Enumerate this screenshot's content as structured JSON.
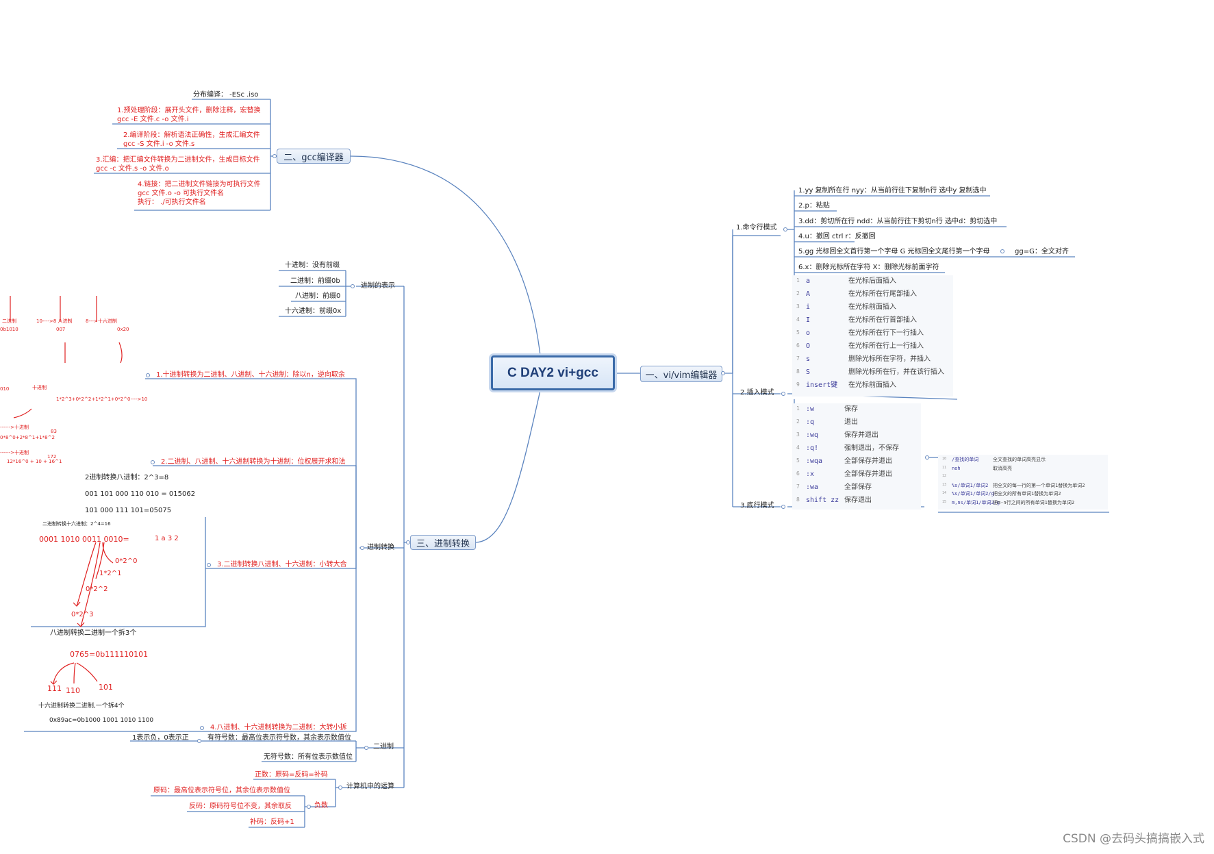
{
  "root": {
    "label": "C DAY2 vi+gcc"
  },
  "branches": {
    "gcc": "二、gcc编译器",
    "vim": "一、vi/vim编辑器",
    "radix": "三、进制转换"
  },
  "gcc_items": {
    "separate": "分布编译：  -ESc  .iso",
    "preprocess": [
      "1.预处理阶段：展开头文件，删除注释，宏替换",
      "gcc -E 文件.c -o 文件.i"
    ],
    "compile": [
      "2.编译阶段：解析语法正确性，生成汇编文件",
      "gcc -S 文件.i -o 文件.s"
    ],
    "assemble": [
      "3.汇编：把汇编文件转换为二进制文件，生成目标文件",
      "gcc -c 文件.s -o 文件.o"
    ],
    "link": [
      "4.链接：把二进制文件链接为可执行文件",
      "gcc 文件.o -o 可执行文件名",
      "执行：  ./可执行文件名"
    ]
  },
  "vim": {
    "command_mode": {
      "label": "1.命令行模式",
      "items": [
        "1.yy 复制所在行 nyy：从当前行往下复制n行 选中y 复制选中",
        "2.p：粘贴",
        "3.dd：剪切所在行 ndd：从当前行往下剪切n行  选中d：剪切选中",
        "4.u：撤回          ctrl r：反撤回",
        "5.gg 光标回全文首行第一个字母 G 光标回全文尾行第一个字母",
        "6.x：删除光标所在字符 X：删除光标前面字符"
      ],
      "extra": "gg=G：全文对齐"
    },
    "insert_mode": {
      "label": "2.插入模式",
      "rows": [
        {
          "n": "1",
          "k": "a",
          "d": "在光标后面插入"
        },
        {
          "n": "2",
          "k": "A",
          "d": "在光标所在行尾部插入"
        },
        {
          "n": "3",
          "k": "i",
          "d": "在光标前面插入"
        },
        {
          "n": "4",
          "k": "I",
          "d": "在光标所在行首部插入"
        },
        {
          "n": "5",
          "k": "o",
          "d": "在光标所在行下一行插入"
        },
        {
          "n": "6",
          "k": "O",
          "d": "在光标所在行上一行插入"
        },
        {
          "n": "7",
          "k": "s",
          "d": "删除光标所在字符，并插入"
        },
        {
          "n": "8",
          "k": "S",
          "d": "删除光标所在行，并在该行插入"
        },
        {
          "n": "9",
          "k": "insert键",
          "d": "在光标前面插入"
        }
      ]
    },
    "lastline_mode": {
      "label": "3.底行模式",
      "rows": [
        {
          "n": "1",
          "k": ":w",
          "d": "保存"
        },
        {
          "n": "2",
          "k": ":q",
          "d": "退出"
        },
        {
          "n": "3",
          "k": ":wq",
          "d": "保存并退出"
        },
        {
          "n": "4",
          "k": ":q!",
          "d": "强制退出，不保存"
        },
        {
          "n": "5",
          "k": ":wqa",
          "d": "全部保存并退出"
        },
        {
          "n": "6",
          "k": ":x",
          "d": "全部保存并退出"
        },
        {
          "n": "7",
          "k": ":wa",
          "d": "全部保存"
        },
        {
          "n": "8",
          "k": "shift zz",
          "d": "保存退出"
        }
      ],
      "search_rows": [
        {
          "n": "10",
          "k": "/查找的单词",
          "d": "全文查找的单词高亮显示"
        },
        {
          "n": "11",
          "k": "noh",
          "d": "取消高亮"
        },
        {
          "n": "12",
          "k": "",
          "d": ""
        },
        {
          "n": "13",
          "k": "%s/单词1/单词2",
          "d": "把全文的每一行的第一个单词1替换为单词2"
        },
        {
          "n": "14",
          "k": "%s/单词1/单词2/g",
          "d": "把全文的所有单词1替换为单词2"
        },
        {
          "n": "15",
          "k": "m,ns/单词1/单词2/g",
          "d": "把m-n行之间的所有单词1替换为单词2"
        }
      ]
    }
  },
  "radix": {
    "representation": {
      "label": "进制的表示",
      "items": [
        "十进制：没有前缀",
        "二进制：前缀0b",
        "八进制：前缀0",
        "十六进制：前缀0x"
      ]
    },
    "conversion": {
      "label": "进制转换",
      "items": [
        "1.十进制转换为二进制、八进制、十六进制：除以n，逆向取余",
        "2.二进制、八进制、十六进制转换为十进制：位权展开求和法",
        "3.二进制转换八进制、十六进制：小转大合",
        "4.八进制、十六进制转换为二进制：大转小拆"
      ],
      "notes": {
        "bin_to_oct": "2进制转换八进制：2^3=8",
        "ex1": "001 101 000 110 010 = 015062",
        "ex2": "101 000 111 101=05075",
        "small_heading": "二进制转换十六进制：2^4=16",
        "hex_digits": "1   a   3     2",
        "bin_example": "0001 1010 0011 0010=",
        "w0": "0*2^0",
        "w1": "1*2^1",
        "w2": "0*2^2",
        "w3": "0*2^3",
        "oct_to_bin": "八进制转换二进制一个拆3个",
        "oct_example": "0765=0b111110101",
        "g1": "111",
        "g2": "110",
        "g3": "101",
        "hex_to_bin": "十六进制转换二进制,一个拆4个",
        "hex_example": "0x89ac=0b1000 1001 1010 1100",
        "sk_labels": [
          "二进制",
          "10---->8 八进制",
          "8--->十六进制"
        ],
        "sk_num": [
          "0b1010",
          "007",
          "0x20"
        ],
        "sk_expr1": "1*2^3+0*2^2+1*2^1+0*2^0---->10",
        "sk_arrow1": "十进制",
        "sk_arrow2": "------>十进制",
        "sk_expr2": "0*8^0+2*8^1+1*8^2",
        "sk_val2": "83",
        "sk_arrow3": "------>十进制",
        "sk_expr3": "12*16^0 + 10 + 16^1",
        "sk_val3": "172",
        "sk_left": "010"
      }
    },
    "binary": {
      "label": "二进制",
      "signed": "有符号数：最高位表示符号数，其余表示数值位",
      "signed_note": "1表示负，0表示正",
      "unsigned": "无符号数：所有位表示数值位"
    },
    "arithmetic": {
      "label": "计算机中的运算",
      "positive": "正数：原码=反码=补码",
      "negative": "负数",
      "neg_items": [
        "原码：最高位表示符号位，其余位表示数值位",
        "反码：原码符号位不变，其余取反",
        "补码：反码+1"
      ]
    }
  },
  "watermark": "CSDN @去码头搞搞嵌入式",
  "colors": {
    "line": "#5b84bf",
    "red": "#e02020",
    "node_border": "#3a6aa8"
  }
}
